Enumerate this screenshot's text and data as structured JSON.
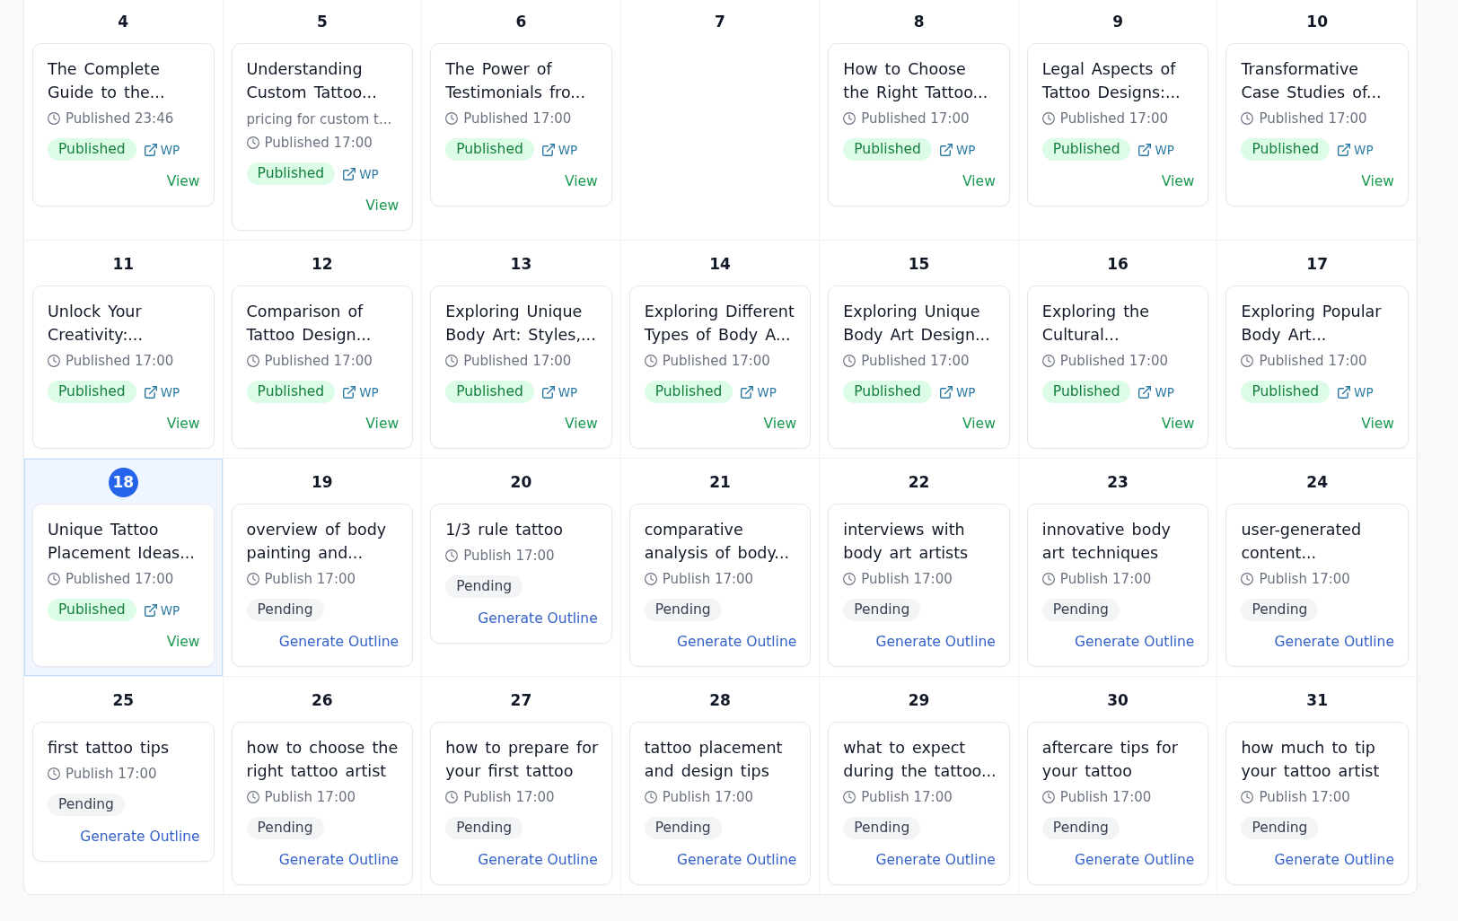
{
  "calendar": {
    "weeks": [
      {
        "days": [
          {
            "day": "4",
            "today": false,
            "post": {
              "kind": "published",
              "title": "The Complete Guide to the...",
              "time": "Published 23:46",
              "status": "Published",
              "link": "WP",
              "action": "View"
            }
          },
          {
            "day": "5",
            "today": false,
            "post": {
              "kind": "published",
              "title": "Understanding Custom Tattoo...",
              "excerpt": "pricing for custom t...",
              "time": "Published 17:00",
              "status": "Published",
              "link": "WP",
              "action": "View"
            }
          },
          {
            "day": "6",
            "today": false,
            "post": {
              "kind": "published",
              "title": "The Power of Testimonials fro...",
              "time": "Published 17:00",
              "status": "Published",
              "link": "WP",
              "action": "View"
            }
          },
          {
            "day": "7",
            "today": false
          },
          {
            "day": "8",
            "today": false,
            "post": {
              "kind": "published",
              "title": "How to Choose the Right Tattoo...",
              "time": "Published 17:00",
              "status": "Published",
              "link": "WP",
              "action": "View"
            }
          },
          {
            "day": "9",
            "today": false,
            "post": {
              "kind": "published",
              "title": "Legal Aspects of Tattoo Designs:...",
              "time": "Published 17:00",
              "status": "Published",
              "link": "WP",
              "action": "View"
            }
          },
          {
            "day": "10",
            "today": false,
            "post": {
              "kind": "published",
              "title": "Transformative Case Studies of...",
              "time": "Published 17:00",
              "status": "Published",
              "link": "WP",
              "action": "View"
            }
          }
        ]
      },
      {
        "days": [
          {
            "day": "11",
            "today": false,
            "post": {
              "kind": "published",
              "title": "Unlock Your Creativity:...",
              "time": "Published 17:00",
              "status": "Published",
              "link": "WP",
              "action": "View"
            }
          },
          {
            "day": "12",
            "today": false,
            "post": {
              "kind": "published",
              "title": "Comparison of Tattoo Design...",
              "time": "Published 17:00",
              "status": "Published",
              "link": "WP",
              "action": "View"
            }
          },
          {
            "day": "13",
            "today": false,
            "post": {
              "kind": "published",
              "title": "Exploring Unique Body Art: Styles,...",
              "time": "Published 17:00",
              "status": "Published",
              "link": "WP",
              "action": "View"
            }
          },
          {
            "day": "14",
            "today": false,
            "post": {
              "kind": "published",
              "title": "Exploring Different Types of Body A...",
              "time": "Published 17:00",
              "status": "Published",
              "link": "WP",
              "action": "View"
            }
          },
          {
            "day": "15",
            "today": false,
            "post": {
              "kind": "published",
              "title": "Exploring Unique Body Art Design...",
              "time": "Published 17:00",
              "status": "Published",
              "link": "WP",
              "action": "View"
            }
          },
          {
            "day": "16",
            "today": false,
            "post": {
              "kind": "published",
              "title": "Exploring the Cultural...",
              "time": "Published 17:00",
              "status": "Published",
              "link": "WP",
              "action": "View"
            }
          },
          {
            "day": "17",
            "today": false,
            "post": {
              "kind": "published",
              "title": "Exploring Popular Body Art...",
              "time": "Published 17:00",
              "status": "Published",
              "link": "WP",
              "action": "View"
            }
          }
        ]
      },
      {
        "days": [
          {
            "day": "18",
            "today": true,
            "post": {
              "kind": "published",
              "title": "Unique Tattoo Placement Ideas...",
              "time": "Published 17:00",
              "status": "Published",
              "link": "WP",
              "action": "View"
            }
          },
          {
            "day": "19",
            "today": false,
            "post": {
              "kind": "pending",
              "title": "overview of body painting and...",
              "time": "Publish 17:00",
              "status": "Pending",
              "action": "Generate Outline"
            }
          },
          {
            "day": "20",
            "today": false,
            "post": {
              "kind": "pending",
              "title": "1/3 rule tattoo",
              "time": "Publish 17:00",
              "status": "Pending",
              "action": "Generate Outline"
            }
          },
          {
            "day": "21",
            "today": false,
            "post": {
              "kind": "pending",
              "title": "comparative analysis of body...",
              "time": "Publish 17:00",
              "status": "Pending",
              "action": "Generate Outline"
            }
          },
          {
            "day": "22",
            "today": false,
            "post": {
              "kind": "pending",
              "title": "interviews with body art artists",
              "time": "Publish 17:00",
              "status": "Pending",
              "action": "Generate Outline"
            }
          },
          {
            "day": "23",
            "today": false,
            "post": {
              "kind": "pending",
              "title": "innovative body art techniques",
              "time": "Publish 17:00",
              "status": "Pending",
              "action": "Generate Outline"
            }
          },
          {
            "day": "24",
            "today": false,
            "post": {
              "kind": "pending",
              "title": "user-generated content...",
              "time": "Publish 17:00",
              "status": "Pending",
              "action": "Generate Outline"
            }
          }
        ]
      },
      {
        "days": [
          {
            "day": "25",
            "today": false,
            "post": {
              "kind": "pending",
              "title": "first tattoo tips",
              "time": "Publish 17:00",
              "status": "Pending",
              "action": "Generate Outline"
            }
          },
          {
            "day": "26",
            "today": false,
            "post": {
              "kind": "pending",
              "title": "how to choose the right tattoo artist",
              "time": "Publish 17:00",
              "status": "Pending",
              "action": "Generate Outline"
            }
          },
          {
            "day": "27",
            "today": false,
            "post": {
              "kind": "pending",
              "title": "how to prepare for your first tattoo",
              "time": "Publish 17:00",
              "status": "Pending",
              "action": "Generate Outline"
            }
          },
          {
            "day": "28",
            "today": false,
            "post": {
              "kind": "pending",
              "title": "tattoo placement and design tips",
              "time": "Publish 17:00",
              "status": "Pending",
              "action": "Generate Outline"
            }
          },
          {
            "day": "29",
            "today": false,
            "post": {
              "kind": "pending",
              "title": "what to expect during the tattoo...",
              "time": "Publish 17:00",
              "status": "Pending",
              "action": "Generate Outline"
            }
          },
          {
            "day": "30",
            "today": false,
            "post": {
              "kind": "pending",
              "title": "aftercare tips for your tattoo",
              "time": "Publish 17:00",
              "status": "Pending",
              "action": "Generate Outline"
            }
          },
          {
            "day": "31",
            "today": false,
            "post": {
              "kind": "pending",
              "title": "how much to tip your tattoo artist",
              "time": "Publish 17:00",
              "status": "Pending",
              "action": "Generate Outline"
            }
          }
        ]
      }
    ]
  }
}
